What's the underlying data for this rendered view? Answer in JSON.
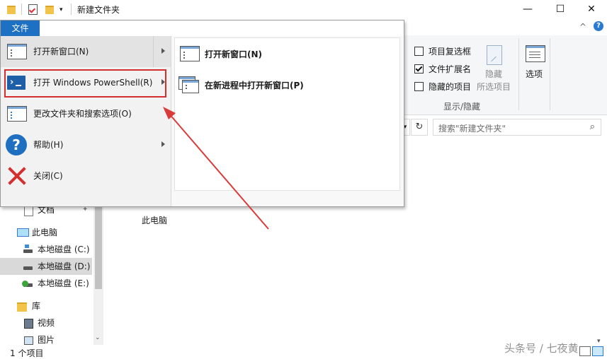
{
  "window": {
    "title": "新建文件夹",
    "minimize_glyph": "—",
    "maximize_glyph": "☐",
    "close_glyph": "✕",
    "help_glyph": "?",
    "collapse_glyph": "^"
  },
  "ribbon": {
    "show_hide": {
      "item_checkboxes": {
        "label": "项目复选框",
        "checked": false
      },
      "file_extensions": {
        "label": "文件扩展名",
        "checked": true
      },
      "hidden_items": {
        "label": "隐藏的项目",
        "checked": false
      },
      "hide_selected_label": "隐藏\n所选项目",
      "hide_label_1": "隐藏",
      "hide_label_2": "所选项目",
      "group_label": "显示/隐藏"
    },
    "options_label": "选项"
  },
  "search": {
    "placeholder": "搜索\"新建文件夹\""
  },
  "file_menu": {
    "tab_label": "文件",
    "items": [
      {
        "label": "打开新窗口(N)",
        "has_submenu": true,
        "icon": "window-icon"
      },
      {
        "label": "打开 Windows PowerShell(R)",
        "has_submenu": true,
        "icon": "powershell-icon",
        "highlighted": true
      },
      {
        "label": "更改文件夹和搜索选项(O)",
        "has_submenu": false,
        "icon": "options-icon"
      },
      {
        "label": "帮助(H)",
        "has_submenu": true,
        "icon": "help-icon"
      },
      {
        "label": "关闭(C)",
        "has_submenu": false,
        "icon": "close-x-icon"
      }
    ],
    "submenu": [
      {
        "label": "打开新窗口(N)",
        "icon": "window-icon"
      },
      {
        "label": "在新进程中打开新窗口(P)",
        "icon": "windows-stack-icon"
      }
    ]
  },
  "nav_pane": {
    "items": [
      {
        "label": "文档",
        "icon": "documents-icon",
        "pinned": true
      },
      {
        "label": "此电脑",
        "icon": "computer-icon"
      },
      {
        "label": "本地磁盘 (C:)",
        "icon": "drive-icon"
      },
      {
        "label": "本地磁盘 (D:)",
        "icon": "drive-icon",
        "selected": true
      },
      {
        "label": "本地磁盘 (E:)",
        "icon": "drive-icon"
      },
      {
        "label": "库",
        "icon": "library-icon"
      },
      {
        "label": "视频",
        "icon": "video-icon"
      },
      {
        "label": "图片",
        "icon": "pictures-icon"
      }
    ]
  },
  "content": {
    "items": [
      {
        "label": "此电脑",
        "icon": "computer-icon"
      }
    ]
  },
  "status": {
    "count": "1 个项目"
  },
  "watermark": "头条号 / 七夜黄",
  "colors": {
    "accent": "#1e70c3",
    "highlight_border": "#d32f2f",
    "arrow": "#d93a3a",
    "selected_row": "#cce8ff"
  }
}
